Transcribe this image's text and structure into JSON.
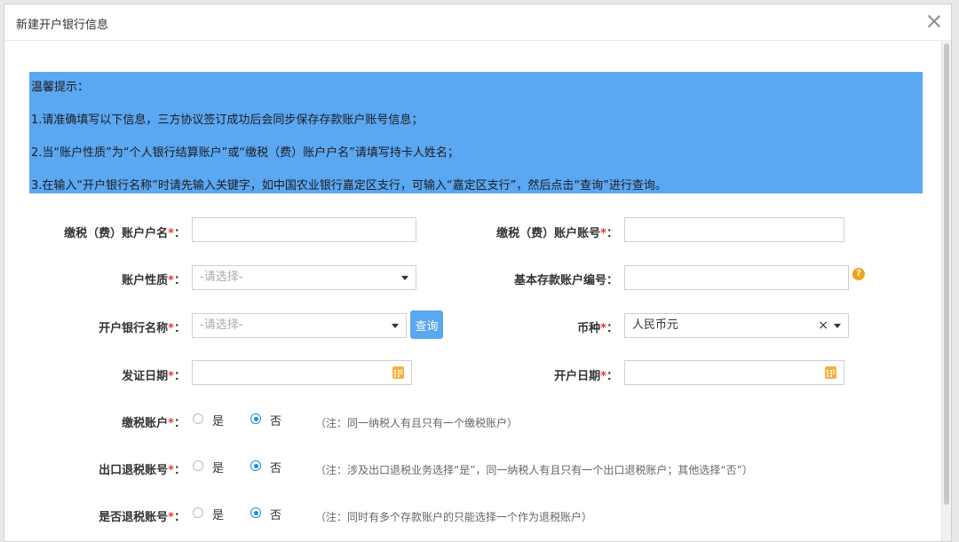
{
  "dialog": {
    "title": "新建开户银行信息"
  },
  "notice": {
    "heading": "温馨提示：",
    "lines": [
      "1.请准确填写以下信息，三方协议签订成功后会同步保存存款账户账号信息；",
      "2.当“账户性质”为“个人银行结算账户”或“缴税（费）账户户名”请填写持卡人姓名；",
      "3.在输入“开户银行名称”时请先输入关键字，如中国农业银行嘉定区支行，可输入“嘉定区支行”，然后点击“查询”进行查询。"
    ]
  },
  "form": {
    "required_mark": "*",
    "colon": "：",
    "account_name": {
      "label": "缴税（费）账户户名",
      "value": ""
    },
    "account_number": {
      "label": "缴税（费）账户账号",
      "value": ""
    },
    "account_type": {
      "label": "账户性质",
      "placeholder": "-请选择-"
    },
    "basic_deposit_no": {
      "label": "基本存款账户编号",
      "value": "",
      "help": "?"
    },
    "bank_name": {
      "label": "开户银行名称",
      "placeholder": "-请选择-",
      "query_button": "查询"
    },
    "currency": {
      "label": "币种",
      "value": "人民币元",
      "clear": "×"
    },
    "issue_date": {
      "label": "发证日期",
      "value": ""
    },
    "open_date": {
      "label": "开户日期",
      "value": ""
    },
    "tax_account": {
      "label": "缴税账户",
      "options": [
        "是",
        "否"
      ],
      "selected": "否",
      "note": "（注：同一纳税人有且只有一个缴税账户）"
    },
    "export_refund_account": {
      "label": "出口退税账号",
      "options": [
        "是",
        "否"
      ],
      "selected": "否",
      "note": "（注：涉及出口退税业务选择“是”，同一纳税人有且只有一个出口退税账户；其他选择“否”）"
    },
    "refund_account": {
      "label": "是否退税账号",
      "options": [
        "是",
        "否"
      ],
      "selected": "否",
      "note": "（注：同时有多个存款账户的只能选择一个作为退税账户）"
    }
  },
  "colors": {
    "accent": "#5aa7f2",
    "required": "#e53935",
    "radio_checked": "#1e88e5",
    "calendar_icon": "#f4b23c",
    "help_icon": "#f0a21c"
  }
}
